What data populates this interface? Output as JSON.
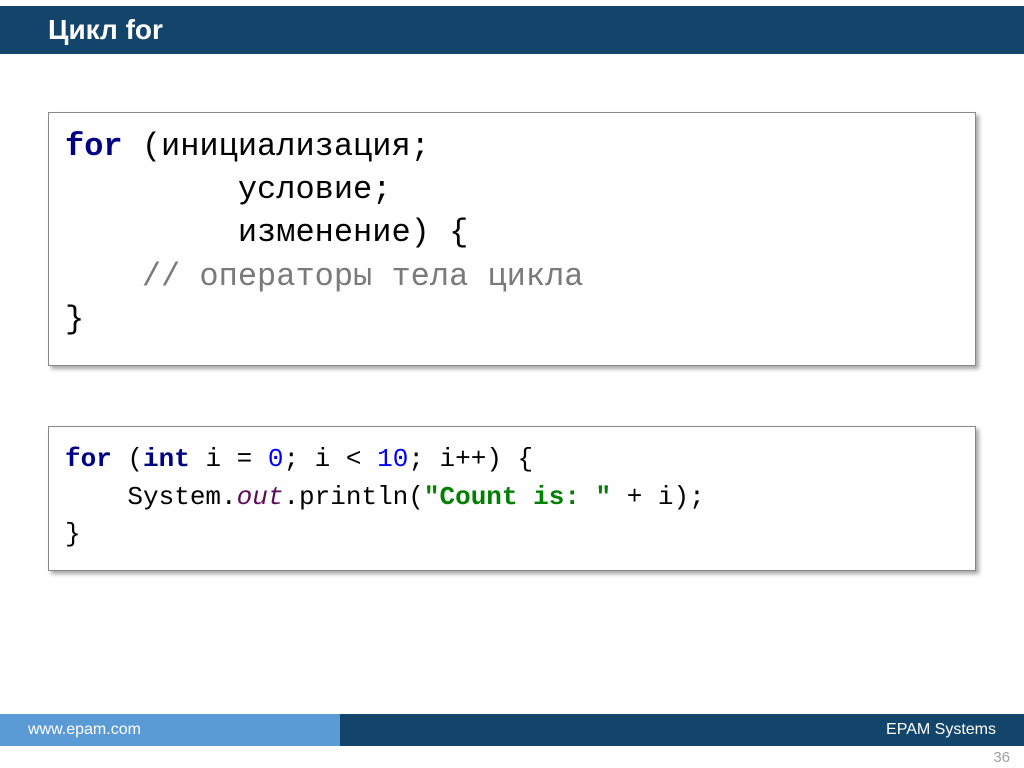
{
  "header": {
    "title": "Цикл for"
  },
  "code1": {
    "tokens": [
      {
        "t": "for",
        "c": "kw"
      },
      {
        "t": " (инициализация;\n",
        "c": "txt"
      },
      {
        "t": "         условие;\n",
        "c": "txt"
      },
      {
        "t": "         изменение) {\n",
        "c": "txt"
      },
      {
        "t": "    // операторы тела цикла\n",
        "c": "comment"
      },
      {
        "t": "}",
        "c": "txt"
      }
    ]
  },
  "code2": {
    "tokens": [
      {
        "t": "for",
        "c": "kw"
      },
      {
        "t": " (",
        "c": "txt"
      },
      {
        "t": "int",
        "c": "kw"
      },
      {
        "t": " i = ",
        "c": "txt"
      },
      {
        "t": "0",
        "c": "num"
      },
      {
        "t": "; i < ",
        "c": "txt"
      },
      {
        "t": "10",
        "c": "num"
      },
      {
        "t": "; i++) {\n",
        "c": "txt"
      },
      {
        "t": "    System.",
        "c": "txt"
      },
      {
        "t": "out",
        "c": "field"
      },
      {
        "t": ".println(",
        "c": "txt"
      },
      {
        "t": "\"Count is: \"",
        "c": "str"
      },
      {
        "t": " + i);\n",
        "c": "txt"
      },
      {
        "t": "}",
        "c": "txt"
      }
    ]
  },
  "footer": {
    "left": "www.epam.com",
    "right": "EPAM Systems"
  },
  "pageNumber": "36"
}
